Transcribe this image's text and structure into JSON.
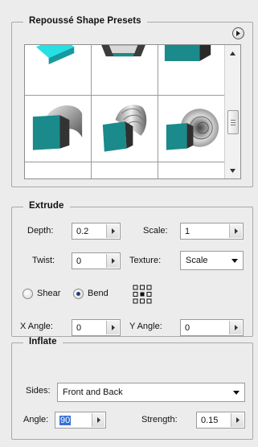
{
  "presets": {
    "title": "Repoussé Shape Presets",
    "accent_color": "#1a8a8a",
    "tiles": [
      {
        "shape": "cyan-slab-edge"
      },
      {
        "shape": "bevel-frame-edge"
      },
      {
        "shape": "teal-block-edge"
      },
      {
        "shape": "bent-cube"
      },
      {
        "shape": "wavy-stack"
      },
      {
        "shape": "spiral-shell"
      },
      {
        "shape": "flat-cube-bottom"
      },
      {
        "shape": "tilted-cube-bottom"
      },
      {
        "shape": "side-cube-bottom"
      }
    ]
  },
  "extrude": {
    "title": "Extrude",
    "depth_label": "Depth:",
    "depth_value": "0.2",
    "scale_label": "Scale:",
    "scale_value": "1",
    "twist_label": "Twist:",
    "twist_value": "0",
    "texture_label": "Texture:",
    "texture_value": "Scale",
    "shear_label": "Shear",
    "bend_label": "Bend",
    "selected_mode": "Bend",
    "x_angle_label": "X Angle:",
    "x_angle_value": "0",
    "y_angle_label": "Y Angle:",
    "y_angle_value": "0"
  },
  "inflate": {
    "title": "Inflate",
    "sides_label": "Sides:",
    "sides_value": "Front and Back",
    "angle_label": "Angle:",
    "angle_value": "90",
    "strength_label": "Strength:",
    "strength_value": "0.15"
  }
}
